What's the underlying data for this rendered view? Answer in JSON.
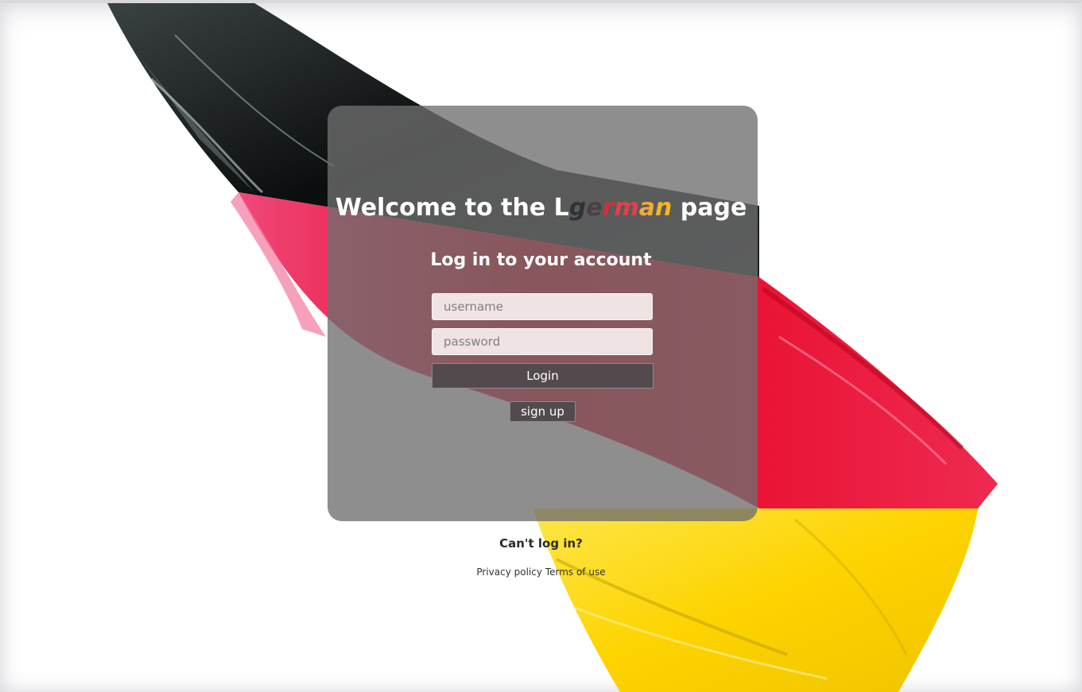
{
  "header": {
    "welcome_prefix": "Welcome to the L",
    "brand_letters": [
      "g",
      "e",
      "r",
      "m",
      "a",
      "n"
    ],
    "brand_colors": [
      "#2f3338",
      "#4a3f42",
      "#d42d3c",
      "#e0404a",
      "#f2a93a",
      "#f7b51e"
    ],
    "welcome_suffix": " page",
    "subtitle": "Log in to your account"
  },
  "form": {
    "username_placeholder": "username",
    "username_value": "",
    "password_placeholder": "password",
    "password_value": "",
    "login_label": "Login",
    "signup_label": "sign up"
  },
  "footer": {
    "cant_login": "Can't log in?",
    "privacy": "Privacy policy",
    "terms": "Terms of use"
  },
  "background": {
    "flag_colors": [
      "#0b0d0e",
      "#e5001d",
      "#fdd300"
    ]
  }
}
